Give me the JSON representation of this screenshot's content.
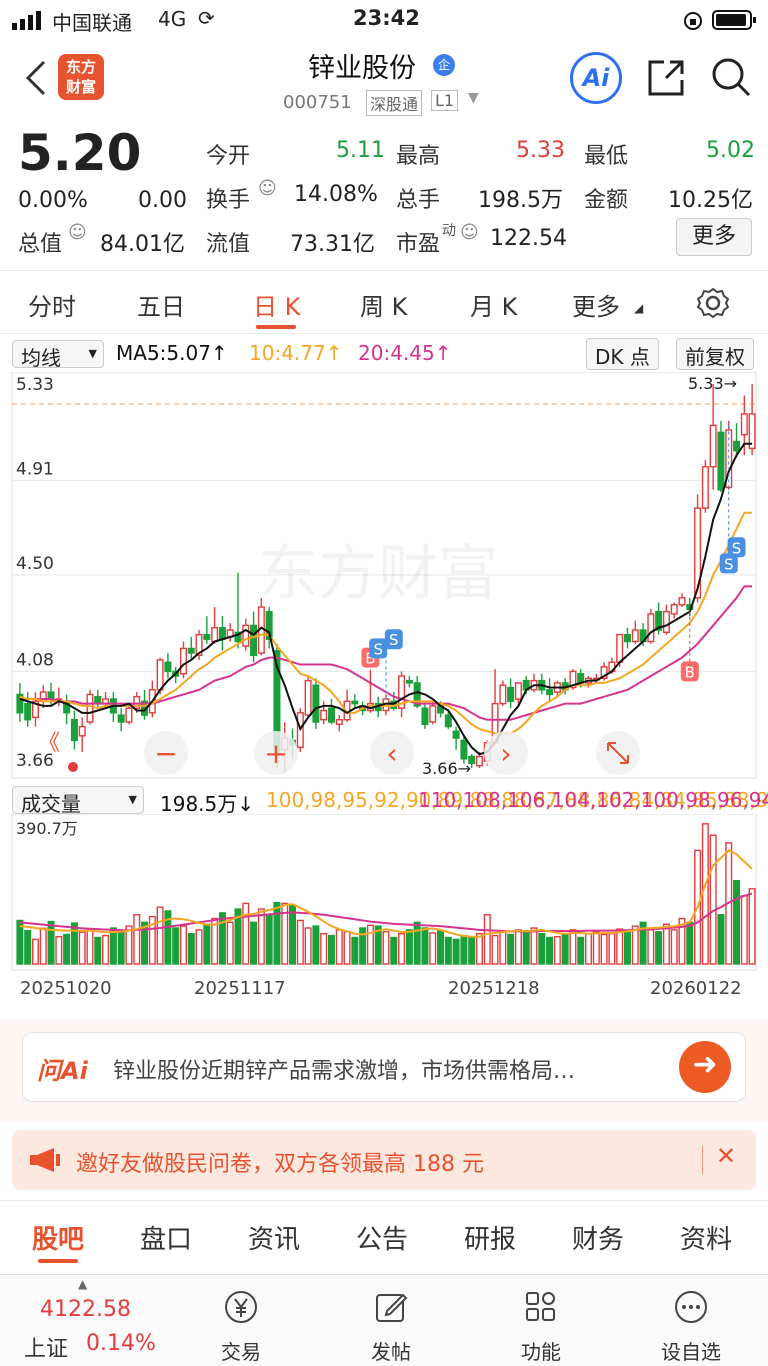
{
  "status_bar": {
    "carrier": "中国联通",
    "network": "4G",
    "time": "23:42"
  },
  "header": {
    "logo_line1": "东方",
    "logo_line2": "财富",
    "title": "锌业股份",
    "title_badge": "企",
    "code": "000751",
    "exchange": "深股通",
    "level": "L1",
    "ai_label": "Ai"
  },
  "quote": {
    "price": "5.20",
    "change_pct": "0.00%",
    "change": "0.00",
    "open_label": "今开",
    "open": "5.11",
    "high_label": "最高",
    "high": "5.33",
    "low_label": "最低",
    "low": "5.02",
    "turnover_label": "换手",
    "turnover": "14.08%",
    "volume_label": "总手",
    "volume": "198.5万",
    "amount_label": "金额",
    "amount": "10.25亿",
    "mktcap_label": "总值",
    "mktcap": "84.01亿",
    "float_label": "流值",
    "float": "73.31亿",
    "pe_label": "市盈",
    "pe_sup": "动",
    "pe": "122.54",
    "more_label": "更多"
  },
  "tabs": [
    "分时",
    "五日",
    "日 K",
    "周 K",
    "月 K",
    "更多"
  ],
  "active_tab": "日 K",
  "kline_toolbar": {
    "indicator": "均线",
    "ma5": "MA5:5.07↑",
    "ma10": "10:4.77↑",
    "ma20": "20:4.45↑",
    "dk": "DK 点",
    "adjust": "前复权"
  },
  "chart_data": {
    "type": "candlestick",
    "price_ticks": [
      "5.33",
      "4.91",
      "4.50",
      "4.08",
      "3.66"
    ],
    "ylim": [
      3.66,
      5.33
    ],
    "high_marker": "5.33→",
    "low_marker": "3.66→",
    "watermark": "东方财富",
    "signal_b": "B",
    "signal_s": "S",
    "date_labels": [
      "20251020",
      "20251117",
      "20251218",
      "20260122"
    ],
    "volume_label": "成交量",
    "volume_value": "198.5万↓",
    "vol_ma1": [
      100,
      98,
      95,
      92,
      90,
      89,
      88,
      88,
      87,
      88,
      86,
      84,
      84,
      85,
      88,
      92,
      98,
      104,
      112,
      118,
      120,
      118,
      114,
      108,
      104,
      104,
      110,
      116,
      124,
      130,
      132,
      138,
      142,
      148,
      155,
      158,
      148,
      138,
      126,
      112,
      100,
      92,
      86,
      80,
      78,
      82,
      88,
      92,
      88,
      84,
      85,
      88,
      92,
      94,
      90,
      84,
      78,
      74,
      72,
      72,
      80,
      82,
      84,
      86,
      88,
      86,
      88,
      90,
      86,
      82,
      80,
      82,
      82,
      80,
      81,
      82,
      82,
      84,
      86,
      90,
      94,
      95,
      96,
      98,
      100,
      104,
      110,
      150,
      210,
      260,
      280,
      300,
      290,
      270,
      251.1
    ],
    "vol_ma2": [
      110,
      108,
      106,
      104,
      102,
      100,
      98,
      96,
      94,
      93,
      92,
      91,
      90,
      89,
      89,
      90,
      91,
      93,
      95,
      98,
      101,
      104,
      107,
      110,
      113,
      116,
      119,
      121,
      123,
      125,
      127,
      129,
      131,
      133,
      135,
      136,
      135,
      134,
      132,
      130,
      127,
      124,
      121,
      118,
      115,
      112,
      110,
      108,
      106,
      105,
      104,
      103,
      102,
      101,
      100,
      98,
      96,
      94,
      92,
      90,
      89,
      88,
      87,
      86,
      86,
      86,
      86,
      87,
      87,
      87,
      87,
      87,
      87,
      88,
      88,
      88,
      88,
      89,
      89,
      90,
      91,
      92,
      93,
      94,
      96,
      98,
      101,
      110,
      125,
      140,
      150,
      162,
      172,
      180,
      186.0
    ],
    "volume_max": "390.7万",
    "ma_colors": {
      "ma5": "#111111",
      "ma10": "#f5a623",
      "ma20": "#d6338f"
    },
    "candles": [
      [
        3.98,
        3.9,
        4.03,
        3.86
      ],
      [
        3.94,
        3.87,
        3.99,
        3.84
      ],
      [
        3.88,
        3.95,
        3.99,
        3.84
      ],
      [
        3.95,
        3.99,
        4.02,
        3.92
      ],
      [
        3.99,
        3.96,
        4.03,
        3.93
      ],
      [
        3.96,
        3.96,
        4.01,
        3.93
      ],
      [
        3.95,
        3.9,
        3.98,
        3.85
      ],
      [
        3.87,
        3.78,
        3.91,
        3.74
      ],
      [
        3.8,
        3.84,
        3.88,
        3.73
      ],
      [
        3.86,
        3.98,
        4.0,
        3.85
      ],
      [
        3.97,
        3.94,
        4.0,
        3.92
      ],
      [
        3.94,
        3.96,
        3.99,
        3.92
      ],
      [
        3.96,
        3.9,
        3.99,
        3.86
      ],
      [
        3.89,
        3.86,
        3.92,
        3.82
      ],
      [
        3.86,
        3.92,
        3.94,
        3.85
      ],
      [
        3.92,
        3.97,
        3.99,
        3.9
      ],
      [
        3.95,
        3.89,
        4.0,
        3.87
      ],
      [
        3.9,
        4.0,
        4.04,
        3.88
      ],
      [
        4.0,
        4.13,
        4.14,
        3.98
      ],
      [
        4.12,
        4.08,
        4.16,
        4.05
      ],
      [
        4.08,
        4.06,
        4.1,
        4.03
      ],
      [
        4.07,
        4.18,
        4.21,
        4.05
      ],
      [
        4.18,
        4.16,
        4.23,
        4.13
      ],
      [
        4.15,
        4.24,
        4.26,
        4.13
      ],
      [
        4.24,
        4.22,
        4.32,
        4.2
      ],
      [
        4.21,
        4.27,
        4.36,
        4.2
      ],
      [
        4.27,
        4.22,
        4.32,
        4.17
      ],
      [
        4.23,
        4.26,
        4.29,
        4.21
      ],
      [
        4.25,
        4.21,
        4.51,
        4.18
      ],
      [
        4.19,
        4.28,
        4.31,
        4.17
      ],
      [
        4.28,
        4.15,
        4.34,
        4.12
      ],
      [
        4.16,
        4.36,
        4.4,
        4.15
      ],
      [
        4.34,
        4.22,
        4.36,
        4.18
      ],
      [
        4.17,
        3.72,
        4.2,
        3.66
      ],
      [
        3.74,
        3.79,
        3.86,
        3.64
      ],
      [
        3.78,
        3.76,
        3.83,
        3.7
      ],
      [
        3.75,
        3.9,
        3.92,
        3.73
      ],
      [
        3.89,
        4.04,
        4.06,
        3.88
      ],
      [
        4.02,
        3.86,
        4.05,
        3.83
      ],
      [
        3.87,
        3.91,
        3.95,
        3.85
      ],
      [
        3.92,
        3.86,
        3.96,
        3.85
      ],
      [
        3.85,
        3.87,
        3.89,
        3.82
      ],
      [
        3.87,
        3.95,
        4.0,
        3.86
      ],
      [
        3.95,
        3.94,
        3.98,
        3.92
      ],
      [
        3.93,
        3.91,
        3.95,
        3.89
      ],
      [
        3.91,
        3.94,
        4.08,
        3.9
      ],
      [
        3.94,
        3.91,
        3.97,
        3.88
      ],
      [
        3.91,
        3.96,
        3.98,
        3.89
      ],
      [
        3.95,
        3.92,
        3.99,
        3.91
      ],
      [
        3.92,
        4.06,
        4.08,
        3.88
      ],
      [
        4.04,
        4.03,
        4.06,
        4.01
      ],
      [
        4.03,
        3.93,
        4.06,
        3.92
      ],
      [
        3.92,
        3.85,
        3.94,
        3.83
      ],
      [
        3.86,
        3.93,
        3.95,
        3.85
      ],
      [
        3.93,
        3.9,
        3.95,
        3.88
      ],
      [
        3.89,
        3.84,
        3.91,
        3.83
      ],
      [
        3.82,
        3.79,
        3.84,
        3.74
      ],
      [
        3.78,
        3.7,
        3.8,
        3.68
      ],
      [
        3.71,
        3.68,
        3.72,
        3.66
      ],
      [
        3.67,
        3.71,
        3.73,
        3.66
      ],
      [
        3.69,
        3.77,
        3.78,
        3.67
      ],
      [
        3.77,
        3.94,
        4.09,
        3.78
      ],
      [
        3.94,
        4.02,
        4.04,
        3.93
      ],
      [
        4.01,
        3.95,
        4.05,
        3.92
      ],
      [
        3.96,
        4.03,
        4.03,
        3.93
      ],
      [
        4.04,
        4.0,
        4.06,
        3.98
      ],
      [
        4.0,
        4.04,
        4.07,
        3.99
      ],
      [
        4.04,
        4.0,
        4.07,
        3.98
      ],
      [
        4.0,
        3.98,
        4.05,
        3.95
      ],
      [
        3.99,
        4.03,
        4.04,
        3.97
      ],
      [
        4.03,
        4.0,
        4.05,
        3.98
      ],
      [
        4.01,
        4.08,
        4.09,
        4.0
      ],
      [
        4.07,
        4.03,
        4.09,
        4.01
      ],
      [
        4.03,
        4.05,
        4.06,
        4.01
      ],
      [
        4.05,
        4.05,
        4.07,
        4.03
      ],
      [
        4.05,
        4.1,
        4.12,
        4.04
      ],
      [
        4.08,
        4.12,
        4.14,
        4.07
      ],
      [
        4.12,
        4.24,
        4.24,
        4.1
      ],
      [
        4.24,
        4.21,
        4.27,
        4.18
      ],
      [
        4.21,
        4.26,
        4.3,
        4.2
      ],
      [
        4.26,
        4.21,
        4.29,
        4.19
      ],
      [
        4.21,
        4.33,
        4.35,
        4.2
      ],
      [
        4.34,
        4.26,
        4.38,
        4.24
      ],
      [
        4.25,
        4.34,
        4.37,
        4.24
      ],
      [
        4.33,
        4.37,
        4.38,
        4.31
      ],
      [
        4.37,
        4.4,
        4.42,
        4.36
      ],
      [
        4.37,
        4.35,
        4.4,
        4.32
      ],
      [
        4.4,
        4.79,
        4.85,
        4.38
      ],
      [
        4.79,
        4.97,
        5.0,
        4.77
      ],
      [
        4.97,
        5.15,
        5.33,
        4.87
      ],
      [
        5.12,
        4.87,
        5.17,
        4.86
      ],
      [
        4.88,
        5.13,
        5.17,
        4.87
      ],
      [
        5.08,
        5.04,
        5.16,
        5.01
      ],
      [
        5.11,
        5.2,
        5.28,
        5.02
      ],
      [
        5.05,
        5.2,
        5.33,
        5.02
      ]
    ],
    "ma5": [
      3.96,
      3.95,
      3.94,
      3.93,
      3.93,
      3.95,
      3.94,
      3.92,
      3.9,
      3.9,
      3.91,
      3.92,
      3.93,
      3.93,
      3.94,
      3.91,
      3.91,
      3.95,
      4.0,
      4.04,
      4.07,
      4.11,
      4.13,
      4.16,
      4.18,
      4.21,
      4.22,
      4.23,
      4.24,
      4.26,
      4.24,
      4.27,
      4.25,
      4.1,
      4.02,
      3.92,
      3.83,
      3.88,
      3.92,
      3.93,
      3.93,
      3.92,
      3.9,
      3.92,
      3.93,
      3.92,
      3.93,
      3.94,
      3.94,
      3.96,
      3.98,
      3.99,
      3.98,
      3.96,
      3.93,
      3.91,
      3.86,
      3.8,
      3.75,
      3.72,
      3.73,
      3.77,
      3.83,
      3.89,
      3.93,
      4.0,
      4.02,
      4.02,
      4.01,
      4.01,
      4.01,
      4.02,
      4.03,
      4.04,
      4.04,
      4.06,
      4.08,
      4.12,
      4.15,
      4.18,
      4.21,
      4.25,
      4.27,
      4.28,
      4.3,
      4.32,
      4.34,
      4.44,
      4.58,
      4.74,
      4.83,
      4.95,
      5.02,
      5.07,
      5.07
    ],
    "ma10": [
      3.97,
      3.96,
      3.96,
      3.95,
      3.95,
      3.95,
      3.95,
      3.94,
      3.93,
      3.93,
      3.92,
      3.93,
      3.93,
      3.93,
      3.93,
      3.93,
      3.93,
      3.94,
      3.96,
      3.98,
      4.0,
      4.03,
      4.06,
      4.09,
      4.11,
      4.14,
      4.16,
      4.18,
      4.2,
      4.22,
      4.23,
      4.24,
      4.24,
      4.19,
      4.15,
      4.11,
      4.07,
      4.06,
      4.04,
      4.02,
      3.99,
      3.95,
      3.9,
      3.9,
      3.92,
      3.93,
      3.93,
      3.93,
      3.93,
      3.94,
      3.95,
      3.95,
      3.95,
      3.95,
      3.94,
      3.93,
      3.91,
      3.88,
      3.85,
      3.83,
      3.82,
      3.81,
      3.81,
      3.81,
      3.83,
      3.86,
      3.9,
      3.93,
      3.95,
      3.97,
      4.0,
      4.02,
      4.02,
      4.02,
      4.03,
      4.03,
      4.04,
      4.05,
      4.07,
      4.09,
      4.11,
      4.14,
      4.17,
      4.2,
      4.23,
      4.26,
      4.29,
      4.34,
      4.41,
      4.5,
      4.56,
      4.63,
      4.7,
      4.77,
      4.77
    ],
    "ma20": [
      3.96,
      3.96,
      3.96,
      3.96,
      3.96,
      3.95,
      3.95,
      3.95,
      3.94,
      3.94,
      3.94,
      3.94,
      3.94,
      3.94,
      3.94,
      3.94,
      3.94,
      3.94,
      3.95,
      3.96,
      3.97,
      3.98,
      3.99,
      4.0,
      4.02,
      4.04,
      4.05,
      4.06,
      4.08,
      4.1,
      4.11,
      4.13,
      4.14,
      4.14,
      4.13,
      4.12,
      4.11,
      4.11,
      4.11,
      4.11,
      4.11,
      4.1,
      4.09,
      4.07,
      4.05,
      4.03,
      4.01,
      3.99,
      3.97,
      3.96,
      3.95,
      3.94,
      3.94,
      3.94,
      3.94,
      3.94,
      3.93,
      3.92,
      3.9,
      3.88,
      3.87,
      3.87,
      3.87,
      3.87,
      3.88,
      3.89,
      3.9,
      3.91,
      3.92,
      3.93,
      3.94,
      3.94,
      3.94,
      3.95,
      3.96,
      3.97,
      3.98,
      3.99,
      4.0,
      4.02,
      4.04,
      4.06,
      4.08,
      4.1,
      4.12,
      4.14,
      4.17,
      4.2,
      4.24,
      4.28,
      4.32,
      4.36,
      4.4,
      4.45,
      4.45
    ],
    "volume": [
      115,
      88,
      65,
      94,
      112,
      72,
      78,
      108,
      84,
      90,
      70,
      75,
      95,
      88,
      100,
      130,
      110,
      125,
      150,
      140,
      95,
      100,
      80,
      90,
      105,
      120,
      135,
      110,
      145,
      160,
      110,
      145,
      130,
      162,
      160,
      155,
      115,
      95,
      100,
      80,
      75,
      90,
      85,
      70,
      95,
      102,
      100,
      85,
      70,
      80,
      90,
      110,
      95,
      82,
      88,
      70,
      65,
      75,
      70,
      80,
      130,
      75,
      85,
      78,
      90,
      88,
      95,
      80,
      70,
      72,
      80,
      90,
      70,
      80,
      85,
      78,
      80,
      92,
      85,
      100,
      110,
      90,
      85,
      105,
      90,
      120,
      110,
      300,
      370,
      340,
      130,
      320,
      220,
      180,
      198.5
    ],
    "controls": {
      "minus": "−",
      "plus": "+",
      "prev": "‹",
      "next": "›",
      "collapse": "《"
    }
  },
  "ai_bar": {
    "label": "问Ai",
    "text": "锌业股份近期锌产品需求激增，市场供需格局…"
  },
  "banner": {
    "text": "邀好友做股民问卷，双方各领最高 188 元"
  },
  "bottom_tabs": [
    "股吧",
    "盘口",
    "资讯",
    "公告",
    "研报",
    "财务",
    "资料"
  ],
  "active_bottom_tab": "股吧",
  "footer": {
    "index_value": "4122.58",
    "index_name": "上证",
    "index_change": "0.14%",
    "items": [
      "交易",
      "发帖",
      "功能",
      "设自选"
    ]
  }
}
